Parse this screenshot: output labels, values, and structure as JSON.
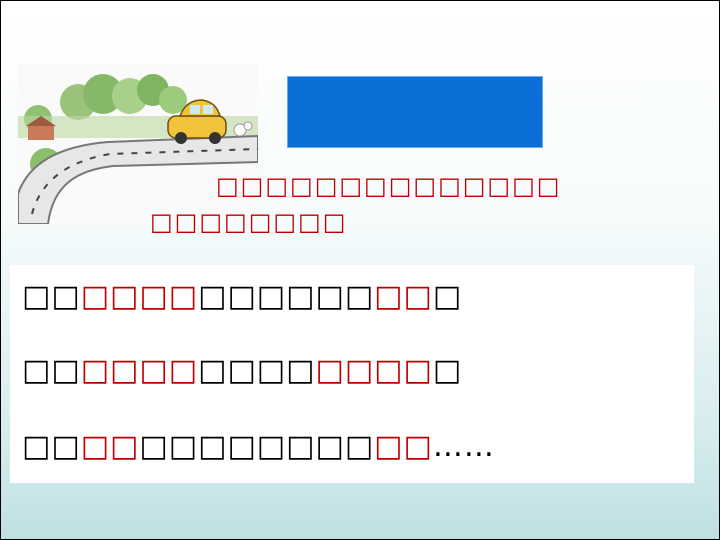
{
  "prompt": {
    "line1": "□□□□□□□□□□□□□□",
    "line2": "□□□□□□□□"
  },
  "examples": {
    "sentence1": {
      "a": "□□",
      "b": "□□□□",
      "c": "□□□□□□",
      "d": "□□",
      "e": "□"
    },
    "sentence2": {
      "a": "□□",
      "b": "□□□□",
      "c": "□□□□",
      "d": "□□□□",
      "e": "□"
    },
    "sentence3": {
      "a": "□□",
      "b": "□□",
      "c": "□□□□□□□□",
      "d": "□□",
      "e": "……"
    }
  },
  "colors": {
    "accent_red": "#c00000",
    "title_box_blue": "#0a6fd7"
  },
  "illustration": {
    "icon": "car-on-road-illustration"
  }
}
